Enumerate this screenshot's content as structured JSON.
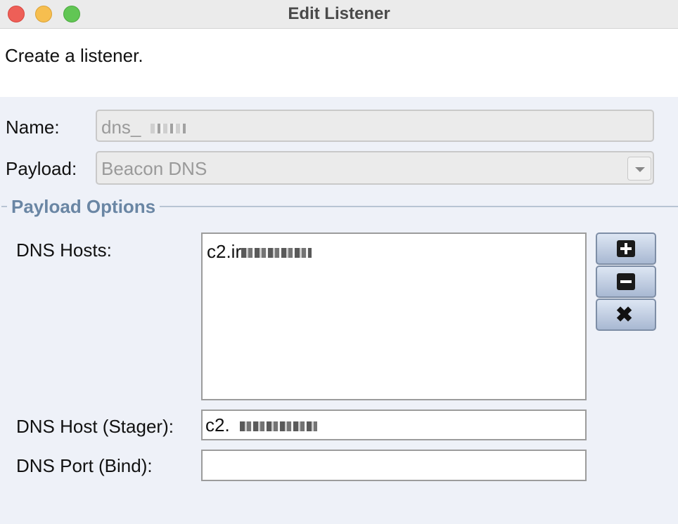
{
  "window": {
    "title": "Edit Listener"
  },
  "description": "Create a listener.",
  "form": {
    "name_label": "Name:",
    "name_value": "dns_",
    "payload_label": "Payload:",
    "payload_value": "Beacon DNS"
  },
  "payload_options": {
    "section_title": "Payload Options",
    "dns_hosts_label": "DNS Hosts:",
    "dns_hosts": [
      "c2.ir"
    ],
    "dns_host_stager_label": "DNS Host (Stager):",
    "dns_host_stager_value": "c2.",
    "dns_port_bind_label": "DNS Port (Bind):",
    "dns_port_bind_value": ""
  },
  "buttons": {
    "add_icon": "plus-icon",
    "remove_icon": "minus-icon",
    "clear_icon": "x-icon"
  }
}
